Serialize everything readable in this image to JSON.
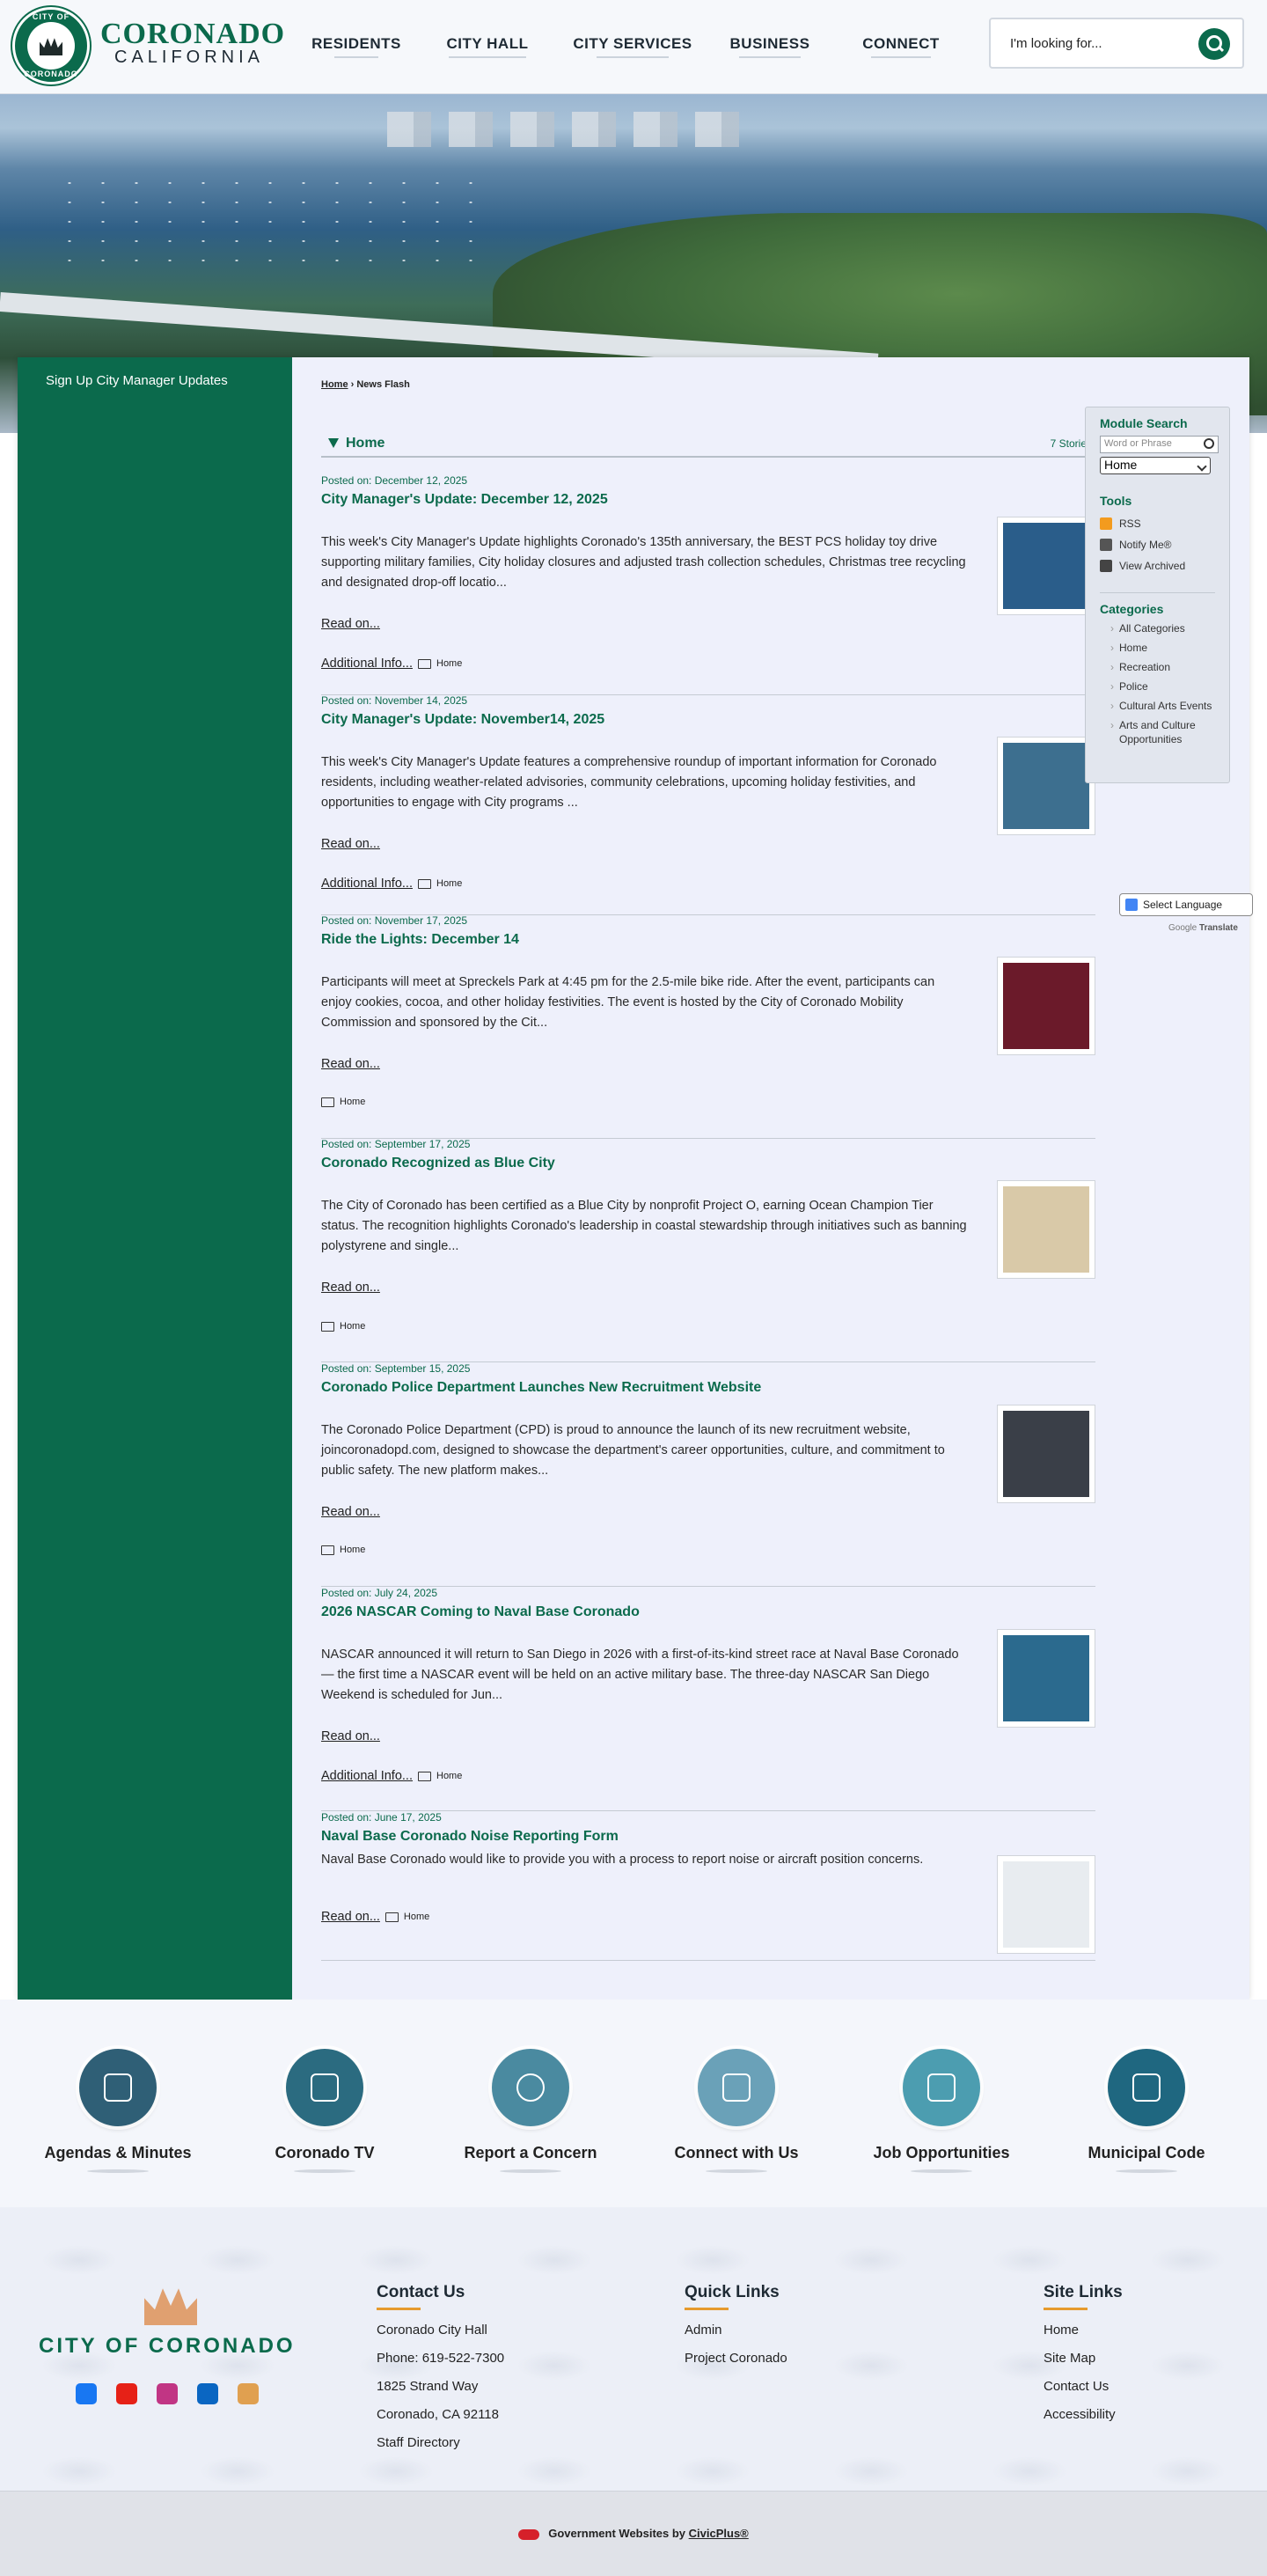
{
  "header": {
    "logo_top_text": "CITY OF",
    "logo_bottom_text": "CORONADO",
    "brand_name": "CORONADO",
    "brand_sub": "CALIFORNIA",
    "nav": [
      "RESIDENTS",
      "CITY HALL",
      "CITY SERVICES",
      "BUSINESS",
      "CONNECT"
    ],
    "search_placeholder": "I'm looking for..."
  },
  "left_nav": {
    "link": "Sign Up City Manager Updates"
  },
  "breadcrumb": {
    "home": "Home",
    "sep": "›",
    "current": "News Flash"
  },
  "module": {
    "title": "Home",
    "count": "7 Stories"
  },
  "stories": [
    {
      "posted": "Posted on: December 12, 2025",
      "title": "City Manager's Update: December 12, 2025",
      "body": "This week's City Manager's Update highlights Coronado's 135th anniversary, the BEST PCS holiday toy drive supporting military families, City holiday closures and adjusted trash collection schedules, Christmas tree recycling and designated drop-off locatio...",
      "read_on": "Read on...",
      "additional": "Additional Info...",
      "category": "Home",
      "thumb_color": "#2a5d8a"
    },
    {
      "posted": "Posted on: November 14, 2025",
      "title": "City Manager's Update: November14, 2025",
      "body": "This week's City Manager's Update features a comprehensive roundup of important information for Coronado residents, including weather-related advisories, community celebrations, upcoming holiday festivities, and opportunities to engage with City programs ...",
      "read_on": "Read on...",
      "additional": "Additional Info...",
      "category": "Home",
      "thumb_color": "#3d6f8f"
    },
    {
      "posted": "Posted on: November 17, 2025",
      "title": "Ride the Lights: December 14",
      "body": "Participants will meet at Spreckels Park at 4:45 pm for the 2.5-mile bike ride. After the event, participants can enjoy cookies, cocoa, and other holiday festivities. The event is hosted by the City of Coronado Mobility Commission and sponsored by the Cit...",
      "read_on": "Read on...",
      "additional": "",
      "category": "Home",
      "thumb_color": "#6b1a2a"
    },
    {
      "posted": "Posted on: September 17, 2025",
      "title": "Coronado Recognized as Blue City",
      "body": "The City of Coronado has been certified as a Blue City by nonprofit Project O, earning Ocean Champion Tier status. The recognition highlights Coronado's leadership in coastal stewardship through initiatives such as banning polystyrene and single...",
      "read_on": "Read on...",
      "additional": "",
      "category": "Home",
      "thumb_color": "#d9c9a8"
    },
    {
      "posted": "Posted on: September 15, 2025",
      "title": "Coronado Police Department Launches New Recruitment Website",
      "body": "The Coronado Police Department (CPD) is proud to announce the launch of its new recruitment website, joincoronadopd.com, designed to showcase the department's career opportunities, culture, and commitment to public safety. The new platform makes...",
      "read_on": "Read on...",
      "additional": "",
      "category": "Home",
      "thumb_color": "#3a3f48"
    },
    {
      "posted": "Posted on: July 24, 2025",
      "title": "2026 NASCAR Coming to Naval Base Coronado",
      "body": "NASCAR announced it will return to San Diego in 2026 with a first-of-its-kind street race at Naval Base Coronado — the first time a NASCAR event will be held on an active military base. The three-day NASCAR San Diego Weekend is scheduled for Jun...",
      "read_on": "Read on...",
      "additional": "Additional Info...",
      "category": "Home",
      "thumb_color": "#2b6a8e"
    },
    {
      "posted": "Posted on: June 17, 2025",
      "title": "Naval Base Coronado Noise Reporting Form",
      "body": "Naval Base Coronado would like to provide you with a process to report noise or aircraft position concerns.",
      "read_on": "Read on...",
      "additional": "",
      "category": "Home",
      "thumb_color": "#e8ecf0"
    }
  ],
  "sidebar": {
    "search_title": "Module Search",
    "search_placeholder": "Word or Phrase",
    "select_value": "Home",
    "tools_title": "Tools",
    "tools": [
      "RSS",
      "Notify Me®",
      "View Archived"
    ],
    "categories_title": "Categories",
    "categories": [
      "All Categories",
      "Home",
      "Recreation",
      "Police",
      "Cultural Arts Events",
      "Arts and Culture Opportunities"
    ]
  },
  "translate": {
    "label": "Select Language",
    "powered": "Google",
    "translate_word": "Translate"
  },
  "quick_links": [
    {
      "label": "Agendas & Minutes",
      "color": "#2f5f76"
    },
    {
      "label": "Coronado TV",
      "color": "#2b6b80"
    },
    {
      "label": "Report a Concern",
      "color": "#4a8aa0"
    },
    {
      "label": "Connect with Us",
      "color": "#6aa1b8"
    },
    {
      "label": "Job Opportunities",
      "color": "#4c9db0"
    },
    {
      "label": "Municipal Code",
      "color": "#1f6780"
    }
  ],
  "footer": {
    "brand": "CITY OF CORONADO",
    "contact_title": "Contact Us",
    "contact": [
      "Coronado City Hall",
      "Phone: 619-522-7300",
      "1825 Strand Way",
      "Coronado, CA 92118",
      "Staff Directory"
    ],
    "quick_title": "Quick Links",
    "quick": [
      "Admin",
      "Project Coronado"
    ],
    "site_title": "Site Links",
    "site": [
      "Home",
      "Site Map",
      "Contact Us",
      "Accessibility"
    ],
    "social": [
      {
        "name": "facebook-icon",
        "color": "#1877f2"
      },
      {
        "name": "youtube-icon",
        "color": "#e62117"
      },
      {
        "name": "instagram-icon",
        "color": "#c13584"
      },
      {
        "name": "linkedin-icon",
        "color": "#0a66c2"
      },
      {
        "name": "tv-icon",
        "color": "#e0a050"
      }
    ]
  },
  "bottom": {
    "text": "Government Websites by ",
    "link": "CivicPlus®"
  }
}
